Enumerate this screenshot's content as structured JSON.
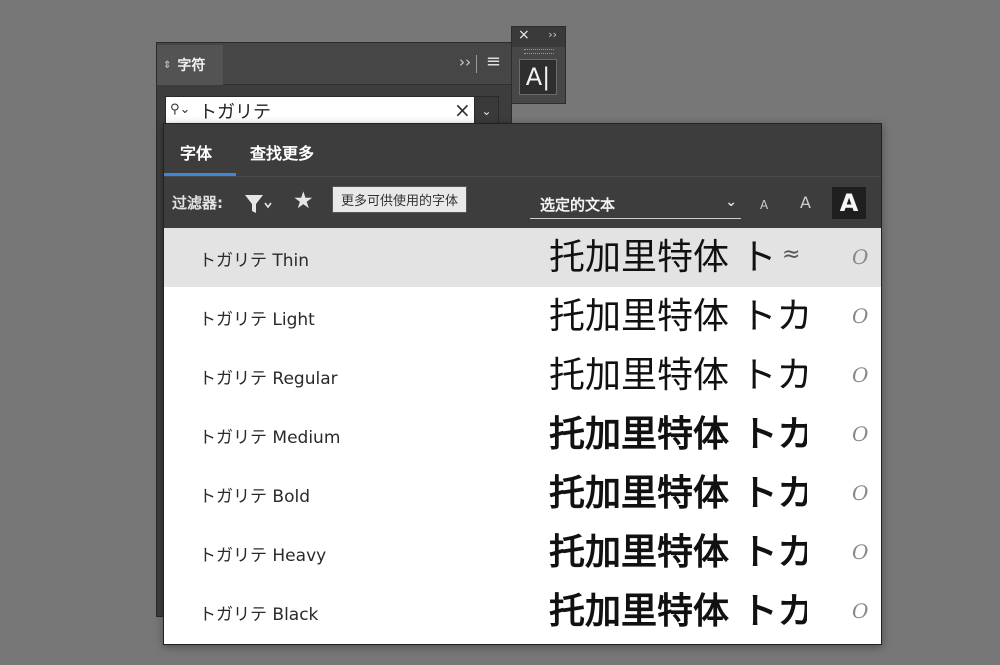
{
  "character_panel": {
    "tab_label": "字符",
    "search_value": "トガリテ",
    "expand_glyph": "››",
    "menu_glyph": "≡"
  },
  "mini_panel": {
    "close_glyph": "×",
    "expand_glyph": "››",
    "button_label": "A|"
  },
  "font_popup": {
    "tabs": [
      {
        "label": "字体",
        "active": true
      },
      {
        "label": "查找更多",
        "active": false
      }
    ],
    "filter_label": "过滤器:",
    "tooltip": "更多可供使用的字体",
    "sample_select": "选定的文本",
    "size_buttons": [
      "A",
      "A",
      "A"
    ],
    "fonts": [
      {
        "name": "トガリテ Thin",
        "sample": "托加里特体 ト",
        "weight": 100,
        "highlighted": true,
        "approx": "≈",
        "type_icon": "O"
      },
      {
        "name": "トガリテ Light",
        "sample": "托加里特体 トカ",
        "weight": 300,
        "highlighted": false,
        "type_icon": "O"
      },
      {
        "name": "トガリテ Regular",
        "sample": "托加里特体 トカ",
        "weight": 400,
        "highlighted": false,
        "type_icon": "O"
      },
      {
        "name": "トガリテ Medium",
        "sample": "托加里特体 トカ",
        "weight": 600,
        "highlighted": false,
        "type_icon": "O"
      },
      {
        "name": "トガリテ Bold",
        "sample": "托加里特体 トカ",
        "weight": 700,
        "highlighted": false,
        "type_icon": "O"
      },
      {
        "name": "トガリテ Heavy",
        "sample": "托加里特体 トカ",
        "weight": 800,
        "highlighted": false,
        "type_icon": "O"
      },
      {
        "name": "トガリテ Black",
        "sample": "托加里特体 トカ",
        "weight": 900,
        "highlighted": false,
        "type_icon": "O"
      }
    ]
  },
  "colors": {
    "background": "#777777",
    "panel": "#3d3d3d",
    "highlight_row": "#e3e3e3",
    "tab_accent": "#3c87d6"
  }
}
